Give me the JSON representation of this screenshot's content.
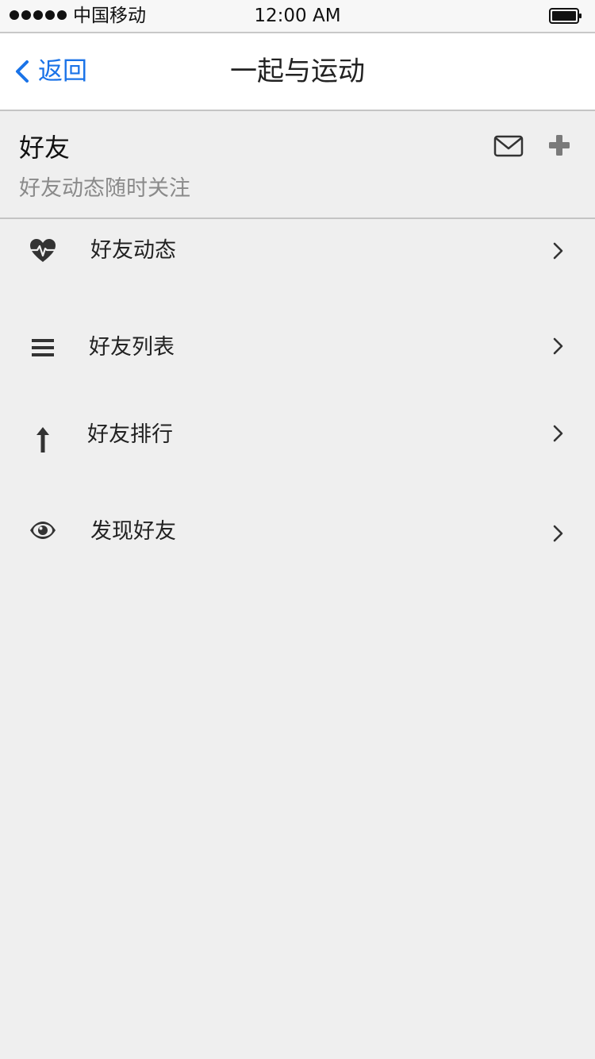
{
  "status_bar": {
    "carrier": "中国移动",
    "time": "12:00 AM"
  },
  "nav": {
    "back_label": "返回",
    "title": "一起与运动"
  },
  "friends": {
    "title": "好友",
    "subtitle": "好友动态随时关注",
    "actions": [
      {
        "icon": "mail-icon"
      },
      {
        "icon": "plus-icon"
      }
    ]
  },
  "menu": {
    "items": [
      {
        "label": "好友动态",
        "icon": "heartbeat-icon"
      },
      {
        "label": "好友列表",
        "icon": "list-icon"
      },
      {
        "label": "好友排行",
        "icon": "arrow-up-icon"
      },
      {
        "label": "发现好友",
        "icon": "eye-icon"
      }
    ]
  },
  "colors": {
    "accent": "#1a73e8",
    "background": "#efefef",
    "nav_background": "#ffffff",
    "subtitle_text": "#8a8a8a",
    "icon": "#333333"
  }
}
